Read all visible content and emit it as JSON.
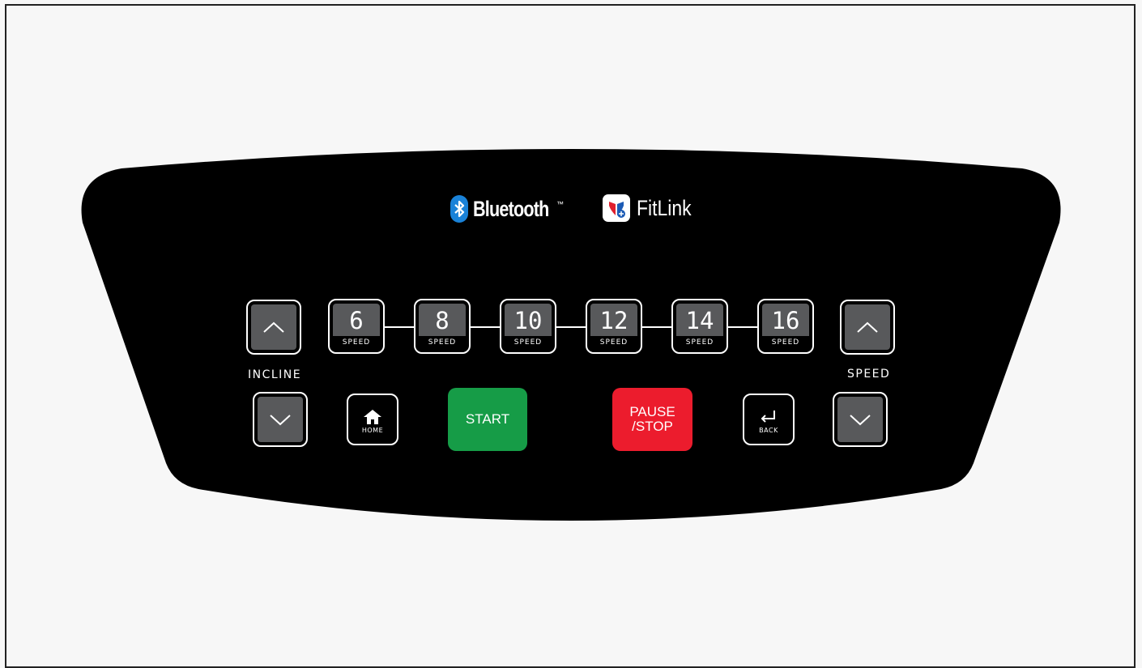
{
  "brands": {
    "bluetooth": {
      "label": "Bluetooth",
      "trademark": "™",
      "icon": "bluetooth-icon",
      "color": "#1a82d8"
    },
    "fitlink": {
      "label": "FitLink",
      "icon": "fitlink-heart-icon"
    }
  },
  "incline": {
    "label": "INCLINE",
    "up_icon": "chevron-up-icon",
    "down_icon": "chevron-down-icon"
  },
  "speed": {
    "label": "SPEED",
    "up_icon": "chevron-up-icon",
    "down_icon": "chevron-down-icon"
  },
  "speed_presets": [
    {
      "value": "6",
      "label": "SPEED"
    },
    {
      "value": "8",
      "label": "SPEED"
    },
    {
      "value": "10",
      "label": "SPEED"
    },
    {
      "value": "12",
      "label": "SPEED"
    },
    {
      "value": "14",
      "label": "SPEED"
    },
    {
      "value": "16",
      "label": "SPEED"
    }
  ],
  "home": {
    "label": "HOME",
    "icon": "home-icon"
  },
  "back": {
    "label": "BACK",
    "icon": "return-arrow-icon"
  },
  "start": {
    "label": "START",
    "color": "#169c47"
  },
  "pause_stop": {
    "line1": "PAUSE",
    "line2": "/STOP",
    "color": "#ec1c2d"
  }
}
